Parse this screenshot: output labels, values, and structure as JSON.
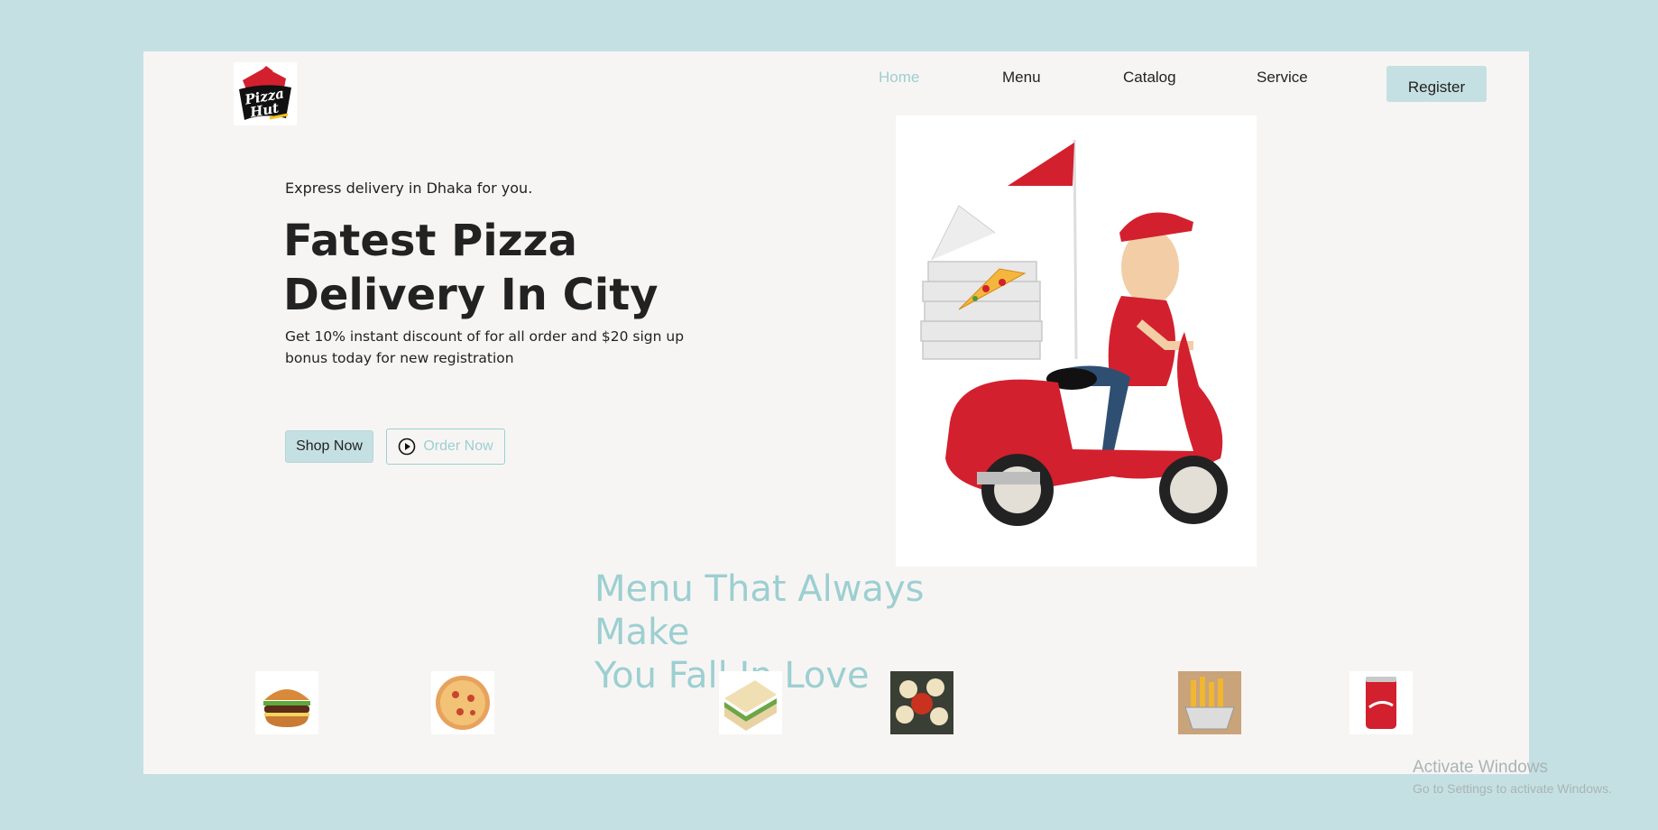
{
  "brand": {
    "logo_text": "Pizza Hut",
    "logo_icon": "pizza-hut-logo"
  },
  "nav": {
    "items": [
      {
        "label": "Home",
        "active": true
      },
      {
        "label": "Menu",
        "active": false
      },
      {
        "label": "Catalog",
        "active": false
      },
      {
        "label": "Service",
        "active": false
      }
    ],
    "register_label": "Register"
  },
  "hero": {
    "tagline": "Express delivery in Dhaka for you.",
    "headline_line1": "Fatest Pizza",
    "headline_line2": "Delivery In City",
    "promo": "Get 10% instant discount of for all order and $20 sign up bonus today for new registration",
    "shop_label": "Shop Now",
    "order_label": "Order Now",
    "order_icon": "play-circle-icon",
    "image": "delivery-scooter-illustration"
  },
  "menu": {
    "title_line1": "Menu That Always Make",
    "title_line2": "You Fall In Love",
    "items": [
      "burger",
      "pizza",
      "sandwich",
      "momo",
      "fries",
      "cola-can"
    ]
  },
  "watermark": {
    "title": "Activate Windows",
    "subtitle": "Go to Settings to activate Windows."
  },
  "colors": {
    "background": "#c5e0e2",
    "page": "#f7f5f3",
    "accent": "#9ccfd1",
    "brand_red": "#d3202e"
  }
}
